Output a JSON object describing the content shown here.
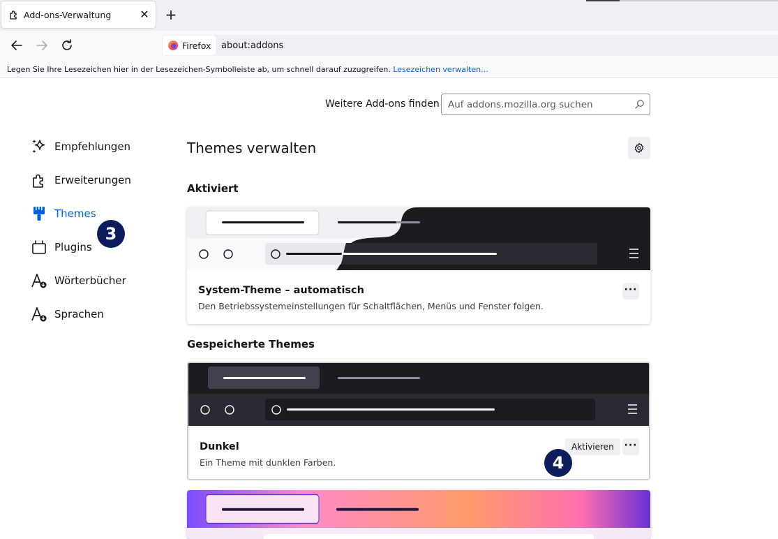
{
  "browser": {
    "tab_title": "Add-ons-Verwaltung",
    "tab_close": "✕",
    "new_tab": "+",
    "identity_label": "Firefox",
    "url": "about:addons",
    "bookmarks_text": "Legen Sie Ihre Lesezeichen hier in der Lesezeichen-Symbolleiste ab, um schnell darauf zuzugreifen.",
    "bookmarks_link": "Lesezeichen verwalten…"
  },
  "header": {
    "find_label": "Weitere Add-ons finden",
    "search_placeholder": "Auf addons.mozilla.org suchen"
  },
  "sidebar": {
    "items": [
      {
        "label": "Empfehlungen",
        "icon": "sparkles-icon"
      },
      {
        "label": "Erweiterungen",
        "icon": "puzzle-icon"
      },
      {
        "label": "Themes",
        "icon": "brush-icon",
        "selected": true
      },
      {
        "label": "Plugins",
        "icon": "plugin-icon"
      },
      {
        "label": "Wörterbücher",
        "icon": "dictionary-icon"
      },
      {
        "label": "Sprachen",
        "icon": "language-icon"
      }
    ]
  },
  "annotations": {
    "badge_3": "3",
    "badge_4": "4"
  },
  "main": {
    "title": "Themes verwalten",
    "active_section": "Aktiviert",
    "saved_section": "Gespeicherte Themes",
    "active_theme": {
      "name": "System-Theme – automatisch",
      "description": "Den Betriebssystemeinstellungen für Schaltflächen, Menüs und Fenster folgen.",
      "more": "···"
    },
    "saved_themes": [
      {
        "name": "Dunkel",
        "description": "Ein Theme mit dunklen Farben.",
        "enable_label": "Aktivieren",
        "more": "···"
      }
    ]
  },
  "colors": {
    "accent": "#0061e0",
    "badge": "#0c1c5c",
    "dark_theme": "#1c1b22"
  }
}
